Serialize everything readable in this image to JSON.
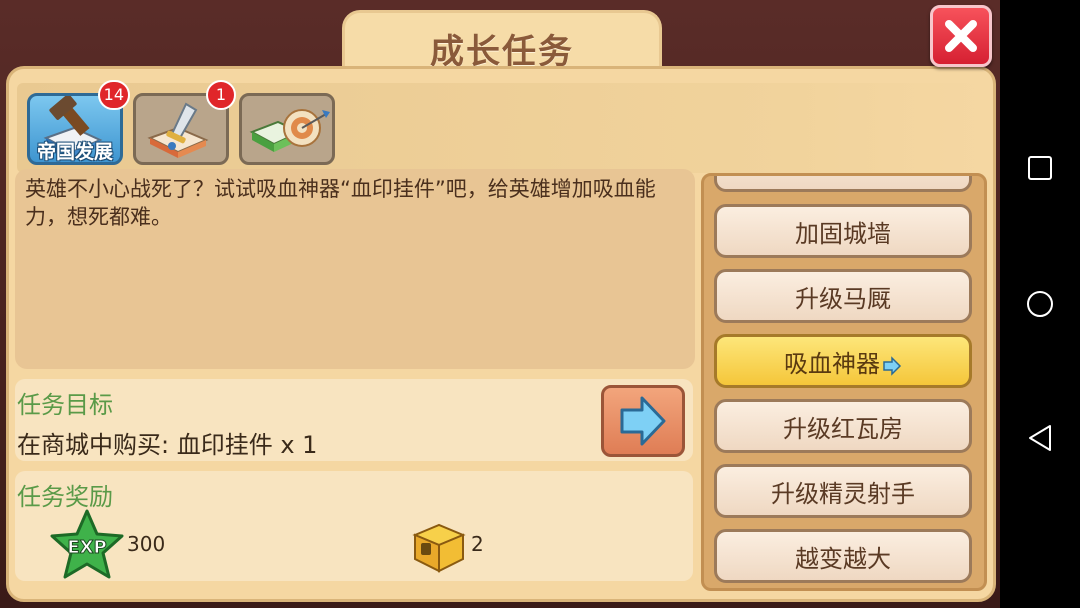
{
  "window": {
    "title": "成长任务"
  },
  "close": {
    "icon": "close-icon",
    "color": "#e8323f"
  },
  "categories": [
    {
      "label": "帝国发展",
      "badge": "14",
      "active": true,
      "icon": "hammer-book-icon"
    },
    {
      "label": "",
      "badge": "1",
      "active": false,
      "icon": "sword-book-icon"
    },
    {
      "label": "",
      "badge": "",
      "active": false,
      "icon": "target-book-icon"
    }
  ],
  "quest": {
    "description": "英雄不小心战死了？试试吸血神器“血印挂件”吧，给英雄增加吸血能力，想死都难。",
    "objective_title": "任务目标",
    "objective_text": "在商城中购买: 血印挂件 x 1",
    "reward_title": "任务奖励",
    "rewards": [
      {
        "icon": "exp-star-icon",
        "qty": "300"
      },
      {
        "icon": "treasure-chest-icon",
        "qty": "2"
      }
    ]
  },
  "task_list": [
    {
      "label": "加固城墙",
      "active": false
    },
    {
      "label": "升级马厩",
      "active": false
    },
    {
      "label": "吸血神器",
      "active": true
    },
    {
      "label": "升级红瓦房",
      "active": false
    },
    {
      "label": "升级精灵射手",
      "active": false
    },
    {
      "label": "越变越大",
      "active": false
    }
  ],
  "colors": {
    "accent_green": "#5a9a48",
    "active_task": "#f5c63a",
    "panel": "#f5d7a2"
  }
}
